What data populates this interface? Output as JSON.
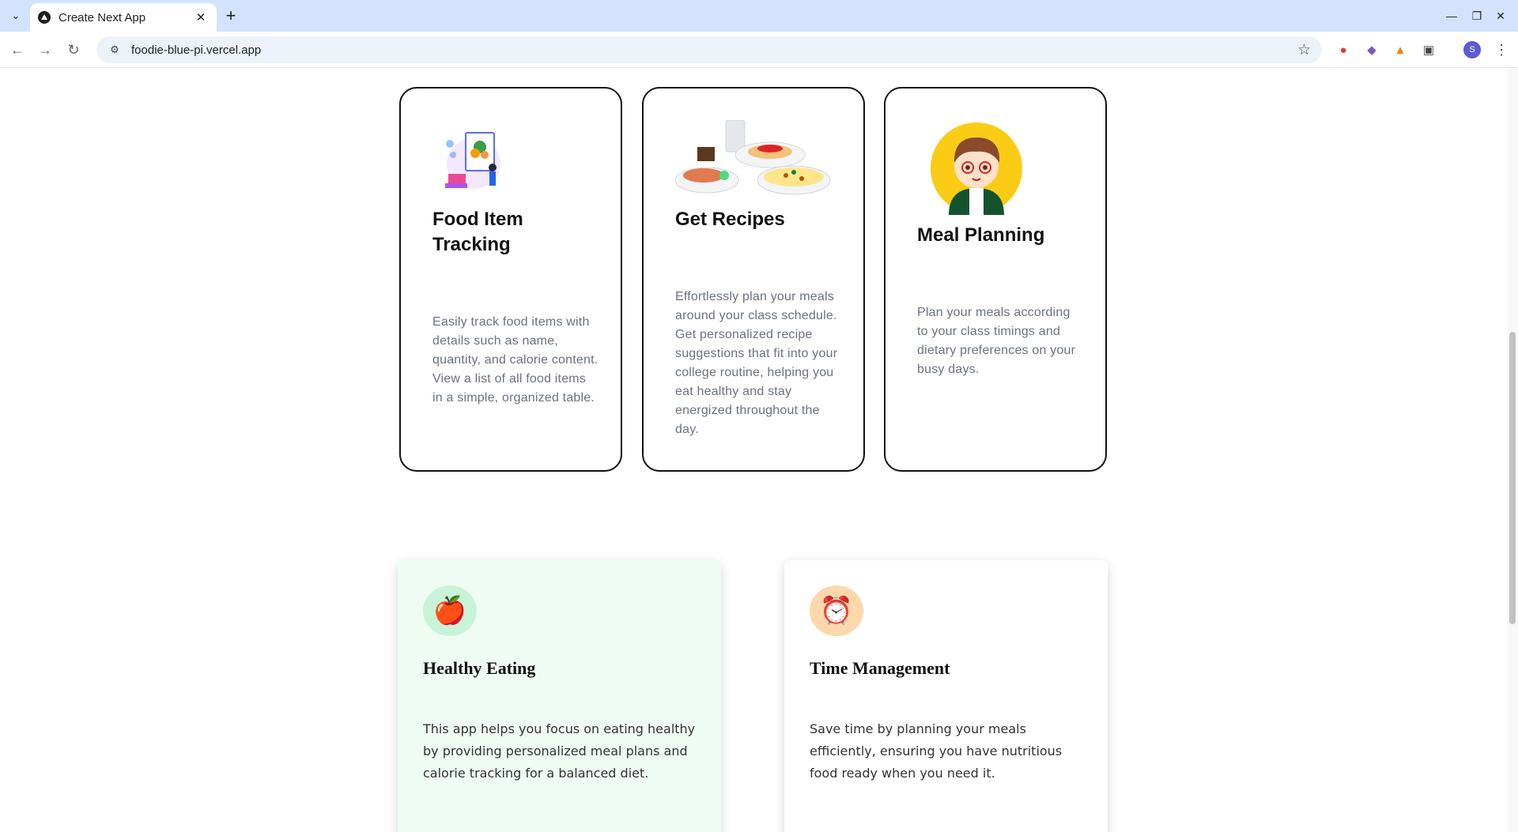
{
  "browser": {
    "tab_title": "Create Next App",
    "url": "foodie-blue-pi.vercel.app",
    "profile_initial": "S"
  },
  "feature_cards": [
    {
      "title": "Food Item Tracking",
      "description": "Easily track food items with details such as name, quantity, and calorie content. View a list of all food items in a simple, organized table.",
      "illustration": "food-tracking-illustration"
    },
    {
      "title": "Get Recipes",
      "description": "Effortlessly plan your meals around your class schedule. Get personalized recipe suggestions that fit into your college routine, helping you eat healthy and stay energized throughout the day.",
      "illustration": "recipes-plates-illustration"
    },
    {
      "title": "Meal Planning",
      "description": "Plan your meals according to your class timings and dietary preferences on your busy days.",
      "illustration": "chef-character-illustration"
    }
  ],
  "benefit_cards": [
    {
      "title": "Healthy Eating",
      "description": "This app helps you focus on eating healthy by providing personalized meal plans and calorie tracking for a balanced diet.",
      "icon": "🍎",
      "background": "#effcf4",
      "icon_bg": "#c9f3d8"
    },
    {
      "title": "Time Management",
      "description": "Save time by planning your meals efficiently, ensuring you have nutritious food ready when you need it.",
      "icon": "⏰",
      "background": "#ffffff",
      "icon_bg": "#fed7aa"
    }
  ]
}
